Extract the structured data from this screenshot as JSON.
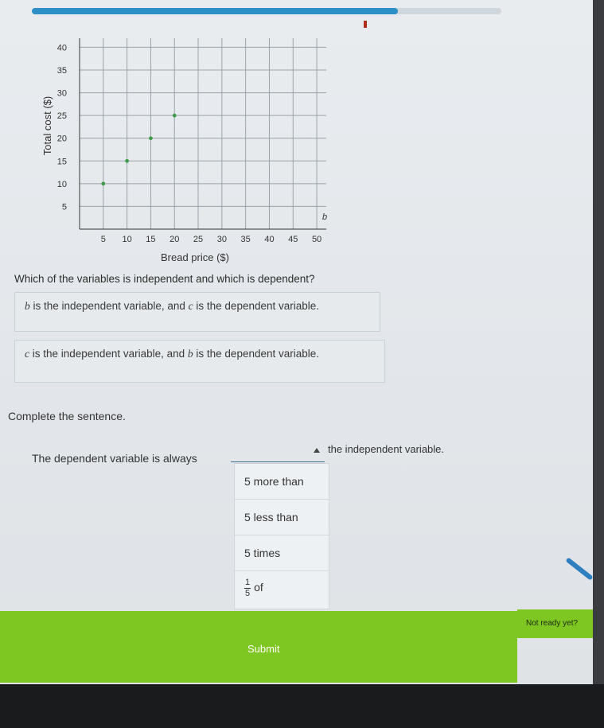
{
  "progress": {
    "fraction": 0.78,
    "color": "#2e8fc7"
  },
  "chart_data": {
    "type": "scatter",
    "xlabel": "Bread price ($)",
    "ylabel": "Total cost ($)",
    "xlim": [
      0,
      52
    ],
    "ylim": [
      0,
      42
    ],
    "xticks": [
      5,
      10,
      15,
      20,
      25,
      30,
      35,
      40,
      45,
      50
    ],
    "yticks": [
      5,
      10,
      15,
      20,
      25,
      30,
      35,
      40
    ],
    "x_axis_letter": "b",
    "grid": true,
    "points": [
      {
        "x": 5,
        "y": 10
      },
      {
        "x": 10,
        "y": 15
      },
      {
        "x": 15,
        "y": 20
      },
      {
        "x": 20,
        "y": 25
      }
    ],
    "point_color": "#3f9a4a"
  },
  "question": "Which of the variables is independent and which is dependent?",
  "choices": [
    {
      "v1": "b",
      "t1": " is the independent variable, and ",
      "v2": "c",
      "t2": " is the dependent variable."
    },
    {
      "v1": "c",
      "t1": " is the independent variable, and ",
      "v2": "b",
      "t2": " is the dependent variable."
    }
  ],
  "instruction": "Complete the sentence.",
  "sentence": {
    "before": "The dependent variable is always",
    "after": "the independent variable."
  },
  "dropdown": {
    "options": [
      "5 more than",
      "5 less than",
      "5 times"
    ],
    "fraction_option": {
      "numerator": "1",
      "denominator": "5",
      "suffix": "of"
    }
  },
  "buttons": {
    "submit": "Submit",
    "not_ready": "Not ready yet?"
  },
  "colors": {
    "submit_bg": "#7ec621",
    "accent": "#2e8fc7"
  }
}
